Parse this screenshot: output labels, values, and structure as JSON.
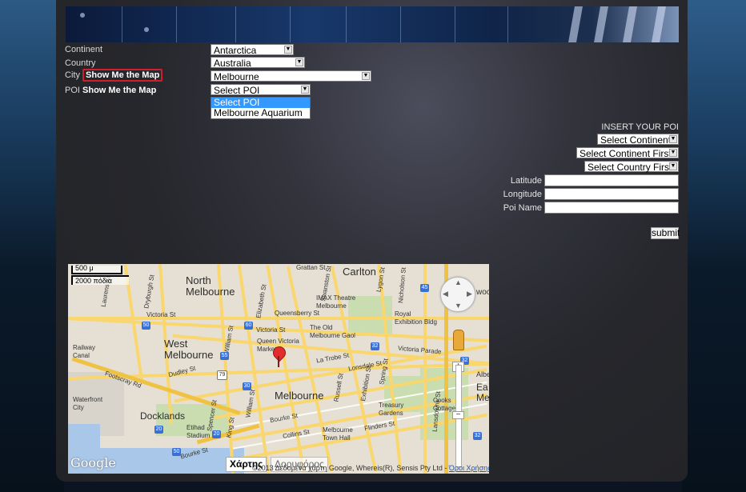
{
  "filters": {
    "continent_label": "Continent",
    "country_label": "Country",
    "city_label": "City",
    "poi_label": "POI",
    "show_map_label": "Show Me the Map",
    "show_map_poi_label": "Show Me the Map",
    "continent_value": "Antarctica",
    "country_value": "Australia",
    "city_value": "Melbourne",
    "poi_value": "Select POI",
    "poi_options": [
      "Select POI",
      "Melbourne Aquarium"
    ],
    "poi_selected_index": 0
  },
  "insert_poi": {
    "title": "INSERT YOUR POI",
    "continent_select": "Select Continent",
    "country_select": "Select Continent First",
    "city_select": "Select Country First",
    "latitude_label": "Latitude",
    "longitude_label": "Longitude",
    "poi_name_label": "Poi Name",
    "latitude_value": "",
    "longitude_value": "",
    "poi_name_value": "",
    "submit_label": "submit"
  },
  "map": {
    "scale_top": "500 μ",
    "scale_bottom": "2000 πόδια",
    "labels": {
      "carlton": "Carlton",
      "north_melbourne": "North\nMelbourne",
      "west_melbourne": "West\nMelbourne",
      "melbourne": "Melbourne",
      "docklands": "Docklands",
      "imax": "IMAX Theatre\nMelbourne",
      "royal_exhibition": "Royal\nExhibition Bldg",
      "queensberry": "Queensberry St",
      "victoria_st": "Victoria St",
      "old_gaol": "The Old\nMelbourne Gaol",
      "queen_victoria": "Queen Victoria\nMarket",
      "la_trobe": "La Trobe St",
      "victoria_parade": "Victoria Parade",
      "lonsdale": "Lonsdale St",
      "bourke": "Bourke St",
      "collins": "Collins St",
      "flinders": "Flinders St",
      "dudley": "Dudley St",
      "footscray": "Footscray Rd",
      "railway_canal": "Railway\nCanal",
      "waterfront": "Waterfront\nCity",
      "etihad": "Etihad\nStadium",
      "treasury": "Treasury\nGardens",
      "cooks_cottage": "Cooks\nCottage",
      "town_hall": "Melbourne\nTown Hall",
      "grattan": "Grattan St",
      "swanston": "Swanston St",
      "lygon": "Lygon St",
      "nicholson": "Nicholson St",
      "elizabeth": "Elizabeth St",
      "william": "William St",
      "spencer": "Spencer St",
      "king": "King St",
      "russell": "Russell St",
      "exhibition_st": "Exhibition St",
      "spring": "Spring St",
      "lansdowne": "Lansdowne St",
      "laurens": "Laurens St",
      "dryburgh": "Dryburgh St",
      "wood": "woo",
      "east_melb": "Ea\nMelb",
      "albe": "Albe",
      "bourke_left": "Bourke St"
    },
    "shields": [
      "45",
      "50",
      "55",
      "60",
      "32",
      "79",
      "30",
      "20",
      "50",
      "20",
      "32",
      "32"
    ],
    "map_type_active": "Χάρτης",
    "map_type_other": "Δορυφόρος",
    "google_logo": "Google",
    "copyright": "©2013 Δεδομένα χάρτη Google, Whereis(R), Sensis Pty Ltd -",
    "terms": "Όροι Χρήσης"
  },
  "colors": {
    "panel_bg": "#2a2b30",
    "highlight_border": "#d01f2a",
    "selected_option": "#3399ff"
  }
}
